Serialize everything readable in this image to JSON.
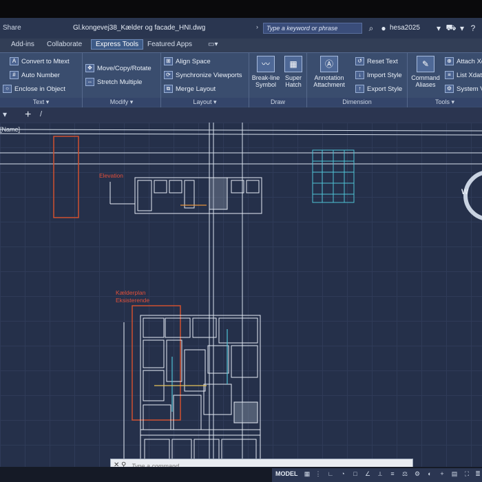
{
  "titlebar": {
    "share_label": "Share",
    "document_title": "Gl.kongevej38_Kælder og facade_HNI.dwg",
    "search_placeholder": "Type a keyword or phrase",
    "username": "hesa2025"
  },
  "tabs": [
    {
      "label": "Add-ins"
    },
    {
      "label": "Collaborate"
    },
    {
      "label": "Express Tools",
      "active": true
    },
    {
      "label": "Featured Apps"
    }
  ],
  "ribbon": {
    "text_panel": {
      "title": "Text ▾",
      "items": [
        "Convert to Mtext",
        "Auto Number",
        "Enclose in Object"
      ]
    },
    "modify_panel": {
      "title": "Modify ▾",
      "items": [
        "Move/Copy/Rotate",
        "Stretch Multiple"
      ]
    },
    "layout_panel": {
      "title": "Layout ▾",
      "items": [
        "Align Space",
        "Synchronize Viewports",
        "Merge Layout"
      ]
    },
    "draw_panel": {
      "title": "Draw",
      "items": [
        "Break-line Symbol",
        "Super Hatch"
      ]
    },
    "dimension_panel": {
      "title": "Dimension",
      "big_item": "Annotation Attachment",
      "items": [
        "Reset Text",
        "Import Style",
        "Export Style"
      ]
    },
    "tools_panel": {
      "title": "Tools ▾",
      "big_item": "Command Aliases",
      "items": [
        "Attach Xd",
        "List Xdata",
        "System Va"
      ]
    }
  },
  "filestrip": {
    "add_label": "+",
    "sep": "/"
  },
  "canvas": {
    "viewport_label": "[Name]",
    "red_label_1": "Elevation",
    "red_label_2_line1": "Kælderplan",
    "red_label_2_line2": "Eksisterende",
    "compass_w": "W"
  },
  "command": {
    "placeholder": "Type a command"
  },
  "status": {
    "model_label": "MODEL"
  },
  "colors": {
    "accent": "#3d5a86",
    "canvas_bg": "#25304a",
    "drawing_lines": "#e6ecf5",
    "red_annotation": "#e4503a",
    "cyan_hatch": "#4fc3d6"
  }
}
